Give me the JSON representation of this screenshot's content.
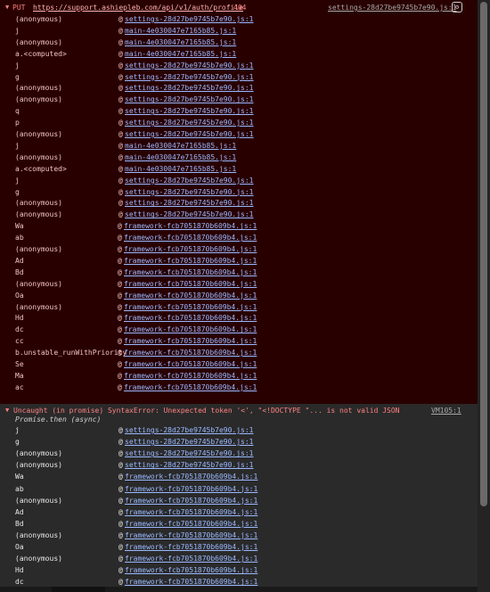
{
  "error_block": {
    "method": "PUT",
    "url": "https://support.ashiepleb.com/api/v1/auth/profile",
    "status": "404",
    "source": "settings-28d27be9745b7e90.js:1",
    "frames": [
      {
        "fn": "(anonymous)",
        "link": "settings-28d27be9745b7e90.js:1"
      },
      {
        "fn": "j",
        "link": "main-4e030047e7165b85.js:1"
      },
      {
        "fn": "(anonymous)",
        "link": "main-4e030047e7165b85.js:1"
      },
      {
        "fn": "a.<computed>",
        "link": "main-4e030047e7165b85.js:1"
      },
      {
        "fn": "j",
        "link": "settings-28d27be9745b7e90.js:1"
      },
      {
        "fn": "g",
        "link": "settings-28d27be9745b7e90.js:1"
      },
      {
        "fn": "(anonymous)",
        "link": "settings-28d27be9745b7e90.js:1"
      },
      {
        "fn": "(anonymous)",
        "link": "settings-28d27be9745b7e90.js:1"
      },
      {
        "fn": "q",
        "link": "settings-28d27be9745b7e90.js:1"
      },
      {
        "fn": "p",
        "link": "settings-28d27be9745b7e90.js:1"
      },
      {
        "fn": "(anonymous)",
        "link": "settings-28d27be9745b7e90.js:1"
      },
      {
        "fn": "j",
        "link": "main-4e030047e7165b85.js:1"
      },
      {
        "fn": "(anonymous)",
        "link": "main-4e030047e7165b85.js:1"
      },
      {
        "fn": "a.<computed>",
        "link": "main-4e030047e7165b85.js:1"
      },
      {
        "fn": "j",
        "link": "settings-28d27be9745b7e90.js:1"
      },
      {
        "fn": "g",
        "link": "settings-28d27be9745b7e90.js:1"
      },
      {
        "fn": "(anonymous)",
        "link": "settings-28d27be9745b7e90.js:1"
      },
      {
        "fn": "(anonymous)",
        "link": "settings-28d27be9745b7e90.js:1"
      },
      {
        "fn": "Wa",
        "link": "framework-fcb7051870b609b4.js:1"
      },
      {
        "fn": "ab",
        "link": "framework-fcb7051870b609b4.js:1"
      },
      {
        "fn": "(anonymous)",
        "link": "framework-fcb7051870b609b4.js:1"
      },
      {
        "fn": "Ad",
        "link": "framework-fcb7051870b609b4.js:1"
      },
      {
        "fn": "Bd",
        "link": "framework-fcb7051870b609b4.js:1"
      },
      {
        "fn": "(anonymous)",
        "link": "framework-fcb7051870b609b4.js:1"
      },
      {
        "fn": "Oa",
        "link": "framework-fcb7051870b609b4.js:1"
      },
      {
        "fn": "(anonymous)",
        "link": "framework-fcb7051870b609b4.js:1"
      },
      {
        "fn": "Hd",
        "link": "framework-fcb7051870b609b4.js:1"
      },
      {
        "fn": "dc",
        "link": "framework-fcb7051870b609b4.js:1"
      },
      {
        "fn": "cc",
        "link": "framework-fcb7051870b609b4.js:1"
      },
      {
        "fn": "b.unstable_runWithPriority",
        "link": "framework-fcb7051870b609b4.js:1"
      },
      {
        "fn": "Se",
        "link": "framework-fcb7051870b609b4.js:1"
      },
      {
        "fn": "Ma",
        "link": "framework-fcb7051870b609b4.js:1"
      },
      {
        "fn": "ac",
        "link": "framework-fcb7051870b609b4.js:1"
      }
    ]
  },
  "uncaught": {
    "message": "Uncaught (in promise) SyntaxError: Unexpected token '<', \"<!DOCTYPE \"... is not valid JSON",
    "source": "VM105:1",
    "async_label": "Promise.then (async)",
    "frames": [
      {
        "fn": "j",
        "link": "settings-28d27be9745b7e90.js:1"
      },
      {
        "fn": "g",
        "link": "settings-28d27be9745b7e90.js:1"
      },
      {
        "fn": "(anonymous)",
        "link": "settings-28d27be9745b7e90.js:1"
      },
      {
        "fn": "(anonymous)",
        "link": "settings-28d27be9745b7e90.js:1"
      },
      {
        "fn": "Wa",
        "link": "framework-fcb7051870b609b4.js:1"
      },
      {
        "fn": "ab",
        "link": "framework-fcb7051870b609b4.js:1"
      },
      {
        "fn": "(anonymous)",
        "link": "framework-fcb7051870b609b4.js:1"
      },
      {
        "fn": "Ad",
        "link": "framework-fcb7051870b609b4.js:1"
      },
      {
        "fn": "Bd",
        "link": "framework-fcb7051870b609b4.js:1"
      },
      {
        "fn": "(anonymous)",
        "link": "framework-fcb7051870b609b4.js:1"
      },
      {
        "fn": "Oa",
        "link": "framework-fcb7051870b609b4.js:1"
      },
      {
        "fn": "(anonymous)",
        "link": "framework-fcb7051870b609b4.js:1"
      },
      {
        "fn": "Hd",
        "link": "framework-fcb7051870b609b4.js:1"
      },
      {
        "fn": "dc",
        "link": "framework-fcb7051870b609b4.js:1"
      }
    ]
  },
  "icons": {
    "expand": "▼",
    "settings": "⚙",
    "at": "@"
  },
  "colors": {
    "error_bg": "#290000",
    "error_text": "#ff8080",
    "link": "#9ab8ff",
    "console_bg": "#242424"
  }
}
